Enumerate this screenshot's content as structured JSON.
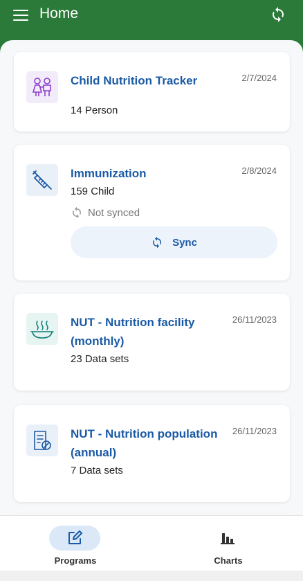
{
  "header": {
    "title": "Home"
  },
  "colors": {
    "primary": "#2c7a3a",
    "accent": "#1b5aa6",
    "nav_active": "#dbe8f8"
  },
  "programs": [
    {
      "title": "Child Nutrition Tracker",
      "subtitle": "14 Person",
      "date": "2/7/2024",
      "icon": "children-icon",
      "icon_bg": "#f1ebfa"
    },
    {
      "title": "Immunization",
      "subtitle": "159 Child",
      "date": "2/8/2024",
      "icon": "syringe-icon",
      "icon_bg": "#eaf0f8",
      "sync_status": "Not synced",
      "sync_label": "Sync"
    },
    {
      "title": "NUT - Nutrition facility (monthly)",
      "subtitle": "23 Data sets",
      "date": "26/11/2023",
      "icon": "steaming-bowl-icon",
      "icon_bg": "#e6f5f2"
    },
    {
      "title": "NUT - Nutrition population (annual)",
      "subtitle": "7 Data sets",
      "date": "26/11/2023",
      "icon": "document-check-icon",
      "icon_bg": "#eaf0f8"
    }
  ],
  "bottom_nav": [
    {
      "label": "Programs",
      "icon": "edit-icon",
      "active": true
    },
    {
      "label": "Charts",
      "icon": "bar-chart-icon",
      "active": false
    }
  ]
}
